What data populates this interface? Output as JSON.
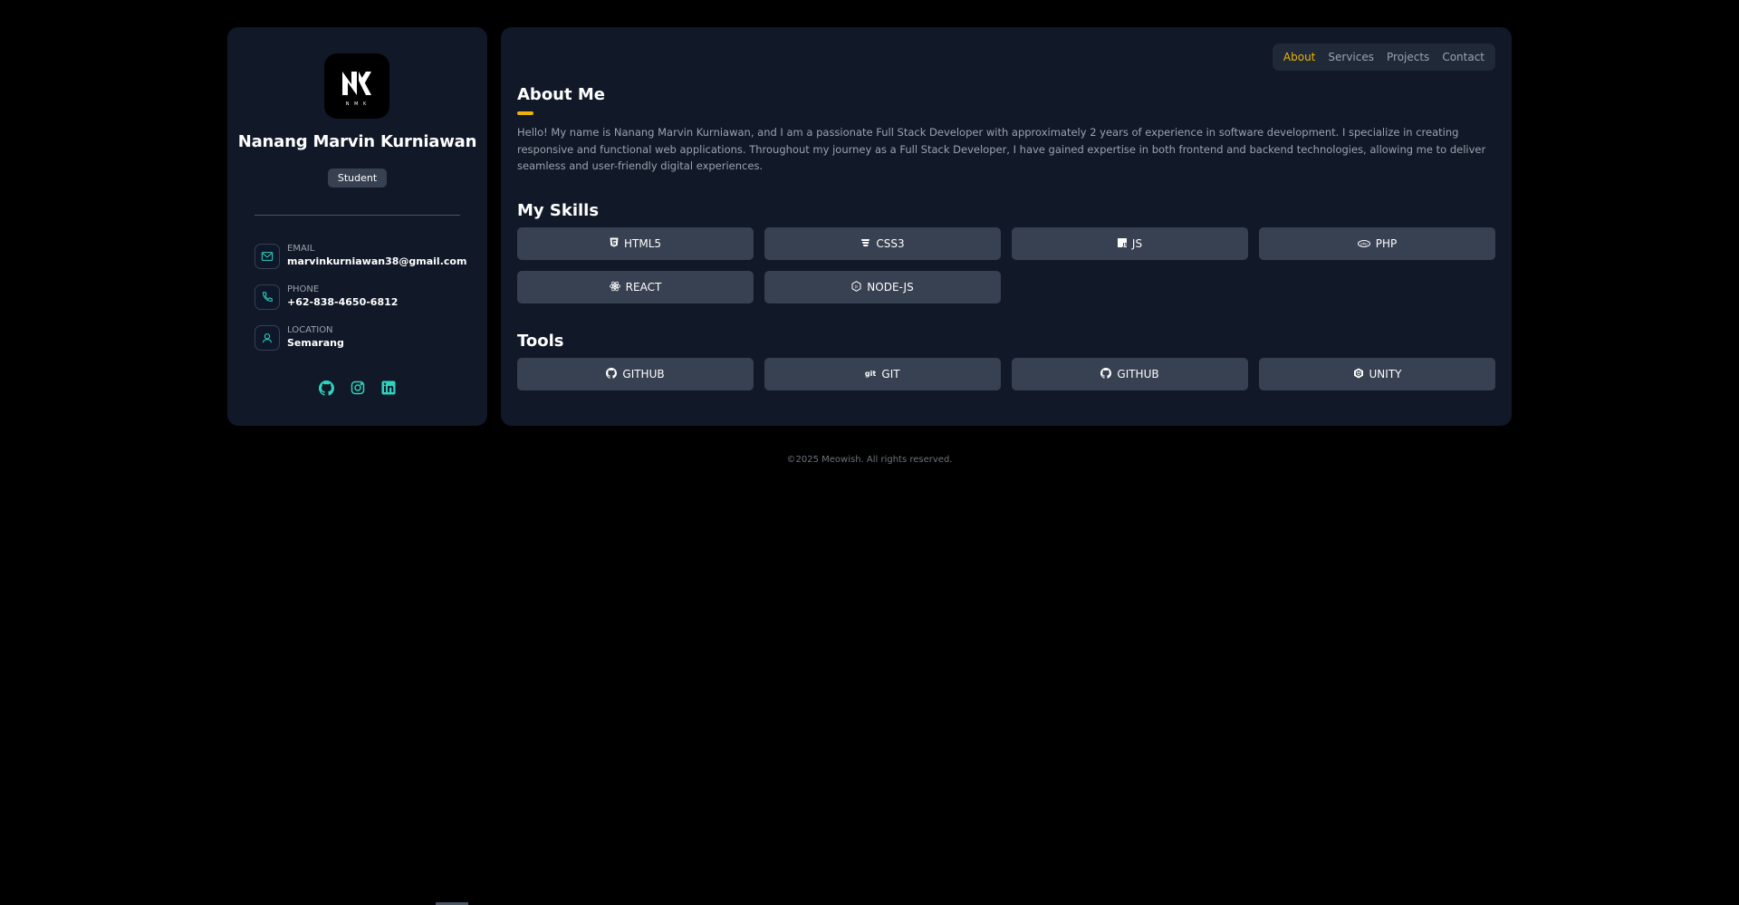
{
  "profile": {
    "logo_icon": "mk-monogram-logo",
    "name": "Nanang Marvin Kurniawan",
    "role": "Student",
    "contacts": [
      {
        "icon": "mail-icon",
        "label": "EMAIL",
        "value": "marvinkurniawan38@gmail.com"
      },
      {
        "icon": "phone-icon",
        "label": "PHONE",
        "value": "+62-838-4650-6812"
      },
      {
        "icon": "location-icon",
        "label": "LOCATION",
        "value": "Semarang"
      }
    ],
    "socials": [
      "github-icon",
      "instagram-icon",
      "linkedin-icon"
    ],
    "accent_color": "#2dd4bf"
  },
  "nav": {
    "items": [
      {
        "label": "About",
        "active": true
      },
      {
        "label": "Services",
        "active": false
      },
      {
        "label": "Projects",
        "active": false
      },
      {
        "label": "Contact",
        "active": false
      }
    ],
    "active_color": "#eab308"
  },
  "about": {
    "title": "About Me",
    "text": "Hello! My name is Nanang Marvin Kurniawan, and I am a passionate Full Stack Developer with approximately 2 years of experience in software development. I specialize in creating responsive and functional web applications. Throughout my journey as a Full Stack Developer, I have gained expertise in both frontend and backend technologies, allowing me to deliver seamless and user-friendly digital experiences."
  },
  "skills": {
    "title": "My Skills",
    "items": [
      {
        "label": "HTML5",
        "icon": "html5-icon"
      },
      {
        "label": "CSS3",
        "icon": "css3-icon"
      },
      {
        "label": "JS",
        "icon": "js-icon"
      },
      {
        "label": "PHP",
        "icon": "php-icon"
      },
      {
        "label": "REACT",
        "icon": "react-icon"
      },
      {
        "label": "NODE-JS",
        "icon": "nodejs-icon"
      }
    ]
  },
  "tools": {
    "title": "Tools",
    "items": [
      {
        "label": "GITHUB",
        "icon": "github-icon"
      },
      {
        "label": "GIT",
        "icon": "git-icon"
      },
      {
        "label": "GITHUB",
        "icon": "github-icon"
      },
      {
        "label": "UNITY",
        "icon": "unity-icon"
      }
    ]
  },
  "footer": {
    "text": "©2025 Meowish. All rights reserved."
  },
  "colors": {
    "background": "#000000",
    "card": "#111827",
    "chip": "#374151"
  }
}
